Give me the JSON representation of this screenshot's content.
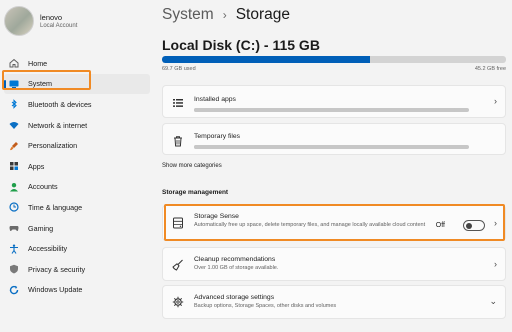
{
  "user": {
    "name": "lenovo",
    "account_type": "Local Account"
  },
  "nav": {
    "items": [
      {
        "label": "Home",
        "icon": "home-icon",
        "color": "#5f5f5f"
      },
      {
        "label": "System",
        "icon": "system-icon",
        "color": "#0067c0",
        "selected": true
      },
      {
        "label": "Bluetooth & devices",
        "icon": "bluetooth-icon",
        "color": "#0078d4"
      },
      {
        "label": "Network & internet",
        "icon": "network-icon",
        "color": "#0a6fc4"
      },
      {
        "label": "Personalization",
        "icon": "brush-icon",
        "color": "#c25c1b"
      },
      {
        "label": "Apps",
        "icon": "apps-icon",
        "color": "#3a3a3a"
      },
      {
        "label": "Accounts",
        "icon": "accounts-icon",
        "color": "#1f9e4a"
      },
      {
        "label": "Time & language",
        "icon": "time-language-icon",
        "color": "#0a6fc4"
      },
      {
        "label": "Gaming",
        "icon": "gaming-icon",
        "color": "#6b6b6b"
      },
      {
        "label": "Accessibility",
        "icon": "accessibility-icon",
        "color": "#0a6fc4"
      },
      {
        "label": "Privacy & security",
        "icon": "shield-icon",
        "color": "#6b6b6b"
      },
      {
        "label": "Windows Update",
        "icon": "update-icon",
        "color": "#0a6fc4"
      }
    ]
  },
  "breadcrumb": {
    "parent": "System",
    "separator": "›",
    "current": "Storage"
  },
  "disk": {
    "title": "Local Disk (C:) - 115 GB",
    "used_label": "69.7 GB used",
    "free_label": "45.2 GB free",
    "used_fraction": 0.606
  },
  "categories": [
    {
      "title": "Installed apps",
      "icon": "installed-apps-icon",
      "fill_fraction": 0.95
    },
    {
      "title": "Temporary files",
      "icon": "trash-icon",
      "fill_fraction": 0.93
    }
  ],
  "show_more": "Show more categories",
  "storage_management": {
    "heading": "Storage management",
    "storage_sense": {
      "title": "Storage Sense",
      "description": "Automatically free up space, delete temporary files, and manage locally available cloud content",
      "toggle_label": "Off",
      "enabled": false
    },
    "cleanup": {
      "title": "Cleanup recommendations",
      "description": "Over 1.00 GB of storage available."
    },
    "advanced": {
      "title": "Advanced storage settings",
      "description": "Backup options, Storage Spaces, other disks and volumes"
    }
  },
  "colors": {
    "accent": "#005fb8",
    "highlight": "#f08a24"
  }
}
